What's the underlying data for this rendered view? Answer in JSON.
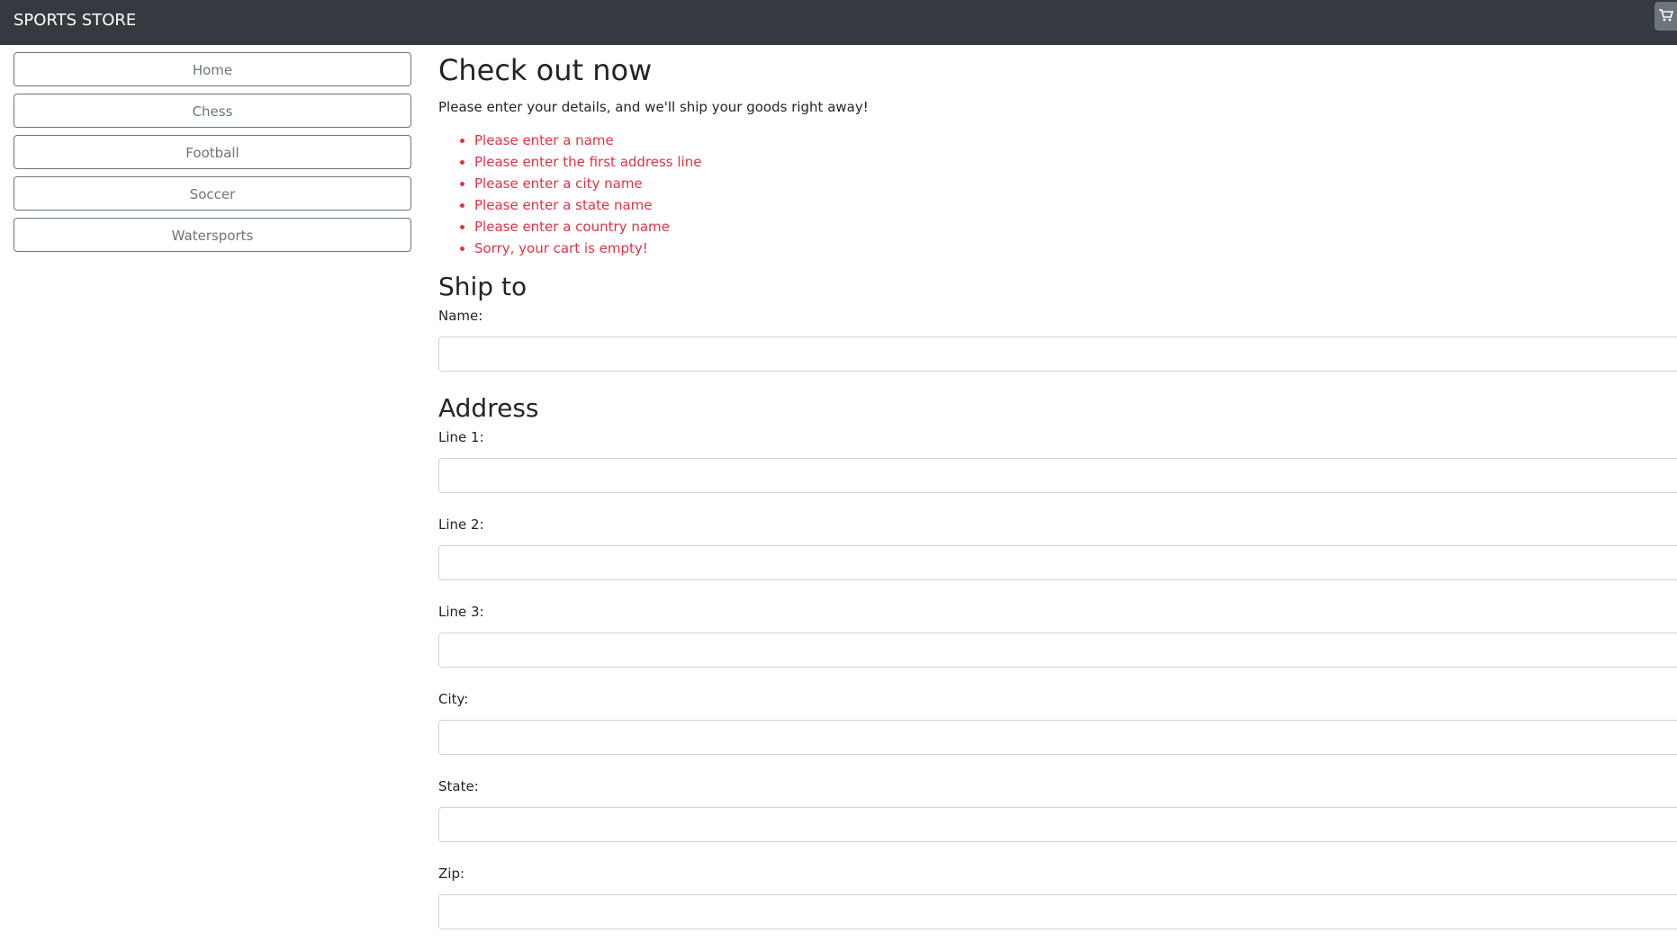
{
  "navbar": {
    "brand": "SPORTS STORE",
    "cart_icon": "cart-icon"
  },
  "sidebar": {
    "items": [
      {
        "label": "Home"
      },
      {
        "label": "Chess"
      },
      {
        "label": "Football"
      },
      {
        "label": "Soccer"
      },
      {
        "label": "Watersports"
      }
    ]
  },
  "main": {
    "title": "Check out now",
    "intro": "Please enter your details, and we'll ship your goods right away!",
    "errors": [
      "Please enter a name",
      "Please enter the first address line",
      "Please enter a city name",
      "Please enter a state name",
      "Please enter a country name",
      "Sorry, your cart is empty!"
    ],
    "ship_to_heading": "Ship to",
    "address_heading": "Address",
    "fields": {
      "name": {
        "label": "Name:",
        "value": ""
      },
      "line1": {
        "label": "Line 1:",
        "value": ""
      },
      "line2": {
        "label": "Line 2:",
        "value": ""
      },
      "line3": {
        "label": "Line 3:",
        "value": ""
      },
      "city": {
        "label": "City:",
        "value": ""
      },
      "state": {
        "label": "State:",
        "value": ""
      },
      "zip": {
        "label": "Zip:",
        "value": ""
      }
    }
  },
  "colors": {
    "navbar_bg": "#343a40",
    "error_text": "#dc3545",
    "secondary": "#6c757d"
  }
}
